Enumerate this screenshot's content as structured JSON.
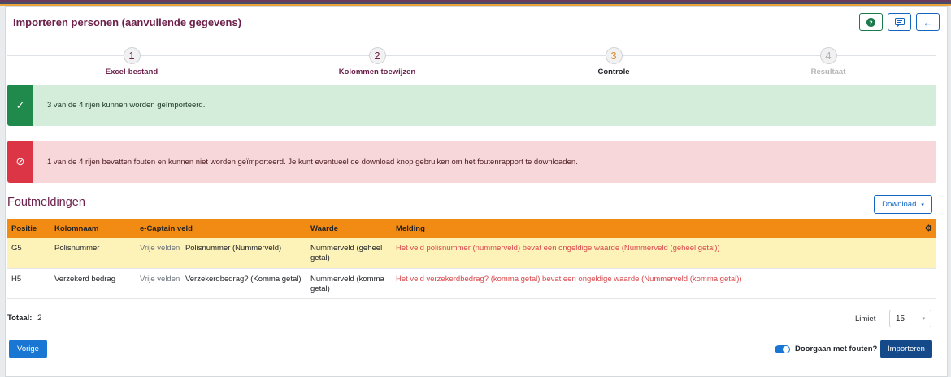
{
  "header": {
    "title": "Importeren personen (aanvullende gegevens)",
    "help_icon": "question-circle-icon",
    "feedback_icon": "feedback-icon",
    "back_icon": "arrow-left-icon",
    "back_glyph": "←"
  },
  "stepper": {
    "steps": [
      {
        "number": "1",
        "label": "Excel-bestand",
        "state": "done"
      },
      {
        "number": "2",
        "label": "Kolommen toewijzen",
        "state": "done"
      },
      {
        "number": "3",
        "label": "Controle",
        "state": "active"
      },
      {
        "number": "4",
        "label": "Resultaat",
        "state": "pending"
      }
    ]
  },
  "alerts": {
    "success": {
      "icon": "check-icon",
      "glyph": "✓",
      "text": "3 van de 4 rijen kunnen worden geïmporteerd."
    },
    "danger": {
      "icon": "ban-icon",
      "glyph": "⊘",
      "text": "1 van de 4 rijen bevatten fouten en kunnen niet worden geïmporteerd. Je kunt eventueel de download knop gebruiken om het foutenrapport te downloaden."
    }
  },
  "errors_section": {
    "title": "Foutmeldingen",
    "download_label": "Download",
    "caret": "▾"
  },
  "table": {
    "columns": [
      "Positie",
      "Kolomnaam",
      "e-Captain veld",
      "Waarde",
      "Melding"
    ],
    "settings_icon": "gear-icon",
    "settings_glyph": "⚙",
    "rows": [
      {
        "positie": "G5",
        "kolomnaam": "Polisnummer",
        "veld_prefix": "Vrije velden",
        "veld": "Polisnummer (Nummerveld)",
        "waarde": "Nummerveld (geheel getal)",
        "melding": "Het veld polisnummer (nummerveld) bevat een ongeldige waarde (Nummerveld (geheel getal))"
      },
      {
        "positie": "H5",
        "kolomnaam": "Verzekerd bedrag",
        "veld_prefix": "Vrije velden",
        "veld": "Verzekerdbedrag? (Komma getal)",
        "waarde": "Nummerveld (komma getal)",
        "melding": "Het veld verzekerdbedrag? (komma getal) bevat een ongeldige waarde (Nummerveld (komma getal))"
      }
    ]
  },
  "footer": {
    "total_label": "Totaal:",
    "total_value": "2",
    "limit_label": "Limiet",
    "limit_value": "15",
    "prev_label": "Vorige",
    "continue_label": "Doorgaan met fouten?",
    "continue_enabled": true,
    "import_label": "Importeren"
  },
  "colors": {
    "brand": "#6b1f4a",
    "primary": "#1565c0",
    "table_header": "#f28b14",
    "highlight_row": "#fdf2b8",
    "error_text": "#d9484d"
  }
}
